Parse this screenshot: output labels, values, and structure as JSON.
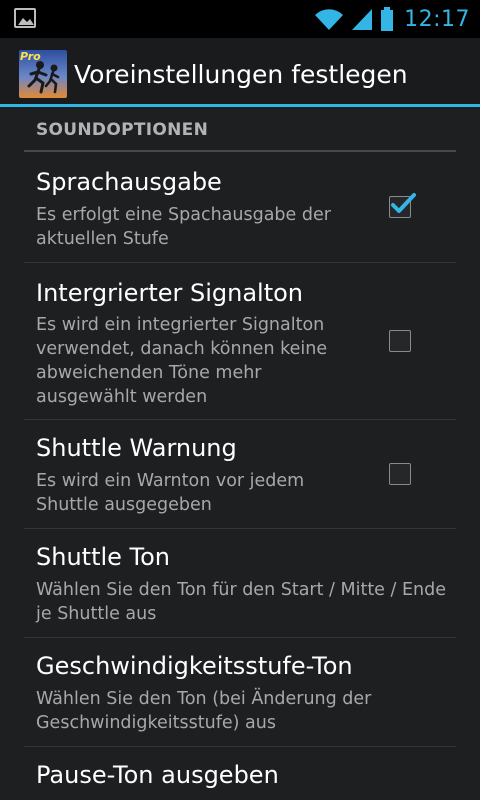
{
  "status_bar": {
    "time": "12:17",
    "icons": [
      "image-icon",
      "wifi-icon",
      "signal-icon",
      "battery-icon"
    ],
    "accent": "#33b5e5"
  },
  "action_bar": {
    "title": "Voreinstellungen festlegen",
    "app_icon_badge": "Pro"
  },
  "section": {
    "header": "SOUNDOPTIONEN"
  },
  "preferences": [
    {
      "title": "Sprachausgabe",
      "summary": "Es erfolgt eine Spachausgabe der aktuellen Stufe",
      "checked": true
    },
    {
      "title": "Intergrierter Signalton",
      "summary": "Es wird ein integrierter Signalton verwendet, danach können keine abweichenden Töne mehr ausgewählt werden",
      "checked": false
    },
    {
      "title": "Shuttle Warnung",
      "summary": "Es wird ein Warnton vor jedem Shuttle ausgegeben",
      "checked": false
    },
    {
      "title": "Shuttle Ton",
      "summary": "Wählen Sie den Ton für den Start / Mitte / Ende je Shuttle aus"
    },
    {
      "title": "Geschwindigkeitsstufe-Ton",
      "summary": "Wählen Sie den Ton (bei Änderung der Geschwindigkeitsstufe) aus"
    },
    {
      "title": "Pause-Ton ausgeben"
    }
  ]
}
